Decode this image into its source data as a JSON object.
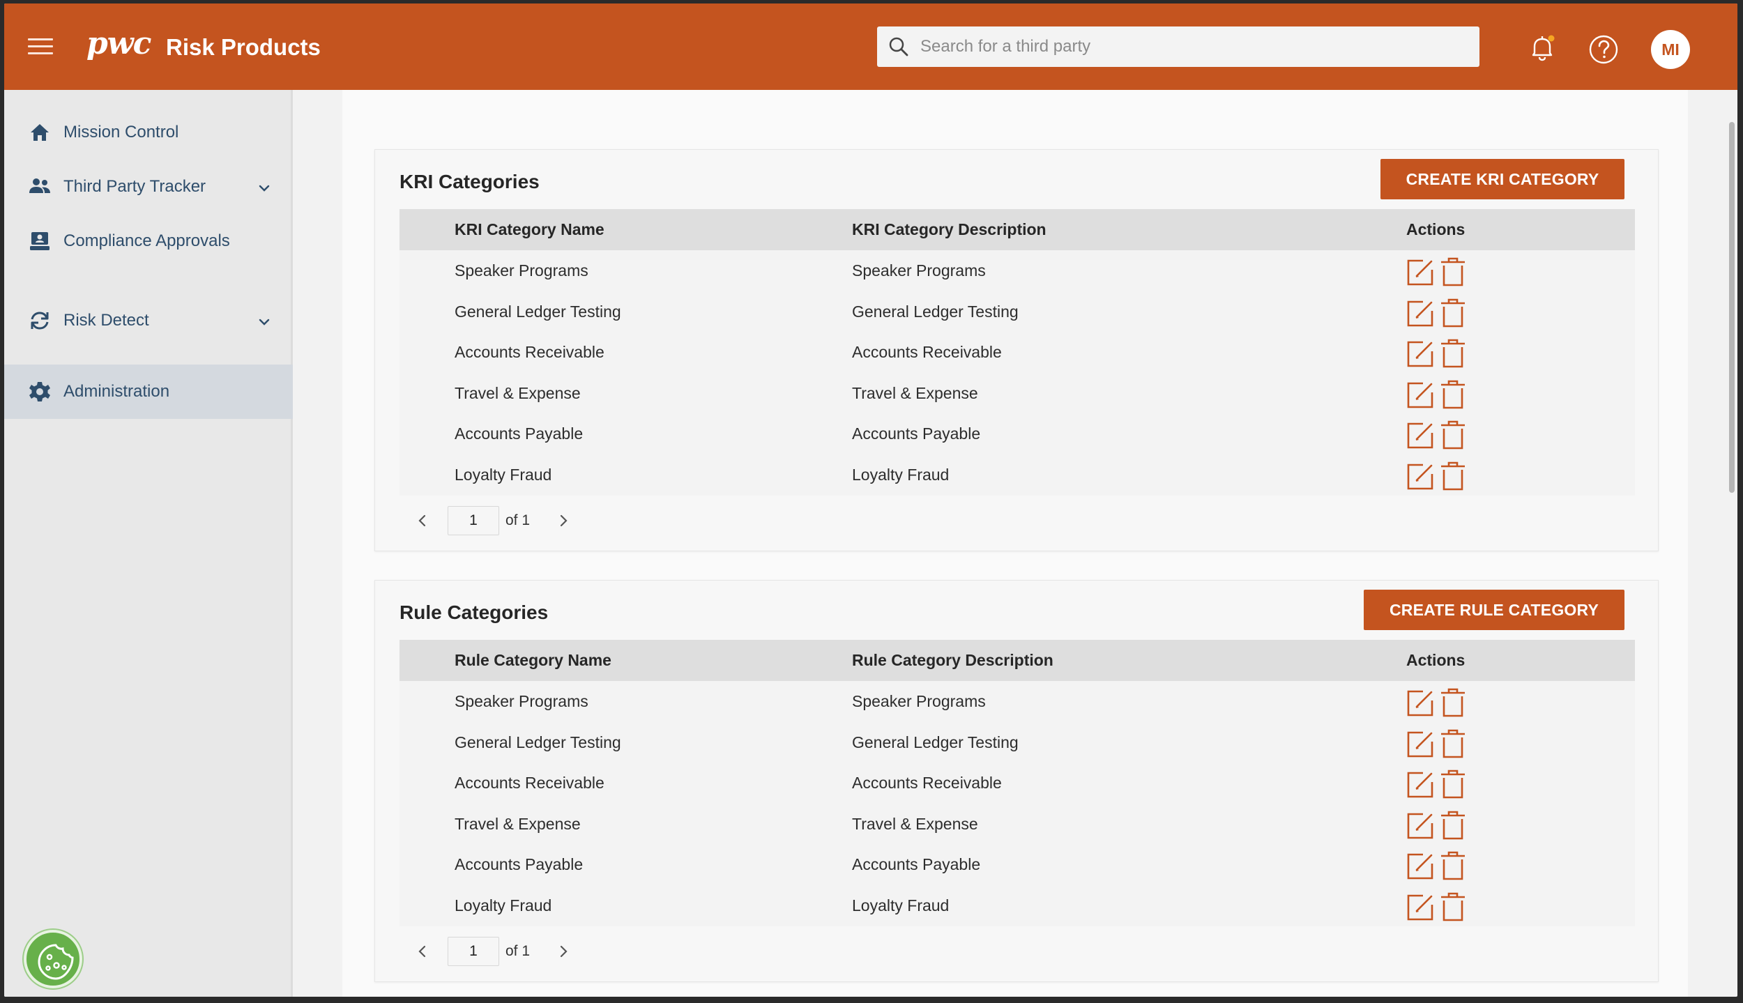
{
  "header": {
    "brand_logo": "pwc",
    "brand_title": "Risk Products",
    "search_placeholder": "Search for a third party",
    "avatar_initials": "MI",
    "accent_color": "#c4541f"
  },
  "sidebar": {
    "items": [
      {
        "label": "Mission Control",
        "icon": "home-icon"
      },
      {
        "label": "Third Party Tracker",
        "icon": "users-icon",
        "expandable": true
      },
      {
        "label": "Compliance Approvals",
        "icon": "compliance-icon"
      },
      {
        "label": "Risk Detect",
        "icon": "sync-icon",
        "expandable": true
      },
      {
        "label": "Administration",
        "icon": "gear-icon",
        "active": true
      }
    ]
  },
  "kri": {
    "title": "KRI Categories",
    "create_label": "CREATE KRI CATEGORY",
    "columns": [
      "KRI Category Name",
      "KRI Category Description",
      "Actions"
    ],
    "rows": [
      [
        "Speaker Programs",
        "Speaker Programs"
      ],
      [
        "General Ledger Testing",
        "General Ledger Testing"
      ],
      [
        "Accounts Receivable",
        "Accounts Receivable"
      ],
      [
        "Travel & Expense",
        "Travel & Expense"
      ],
      [
        "Accounts Payable",
        "Accounts Payable"
      ],
      [
        "Loyalty Fraud",
        "Loyalty Fraud"
      ]
    ],
    "pager": {
      "page": "1",
      "of_label": "of 1"
    }
  },
  "rule": {
    "title": "Rule Categories",
    "create_label": "CREATE RULE CATEGORY",
    "columns": [
      "Rule Category Name",
      "Rule Category Description",
      "Actions"
    ],
    "rows": [
      [
        "Speaker Programs",
        "Speaker Programs"
      ],
      [
        "General Ledger Testing",
        "General Ledger Testing"
      ],
      [
        "Accounts Receivable",
        "Accounts Receivable"
      ],
      [
        "Travel & Expense",
        "Travel & Expense"
      ],
      [
        "Accounts Payable",
        "Accounts Payable"
      ],
      [
        "Loyalty Fraud",
        "Loyalty Fraud"
      ]
    ],
    "pager": {
      "page": "1",
      "of_label": "of 1"
    }
  }
}
